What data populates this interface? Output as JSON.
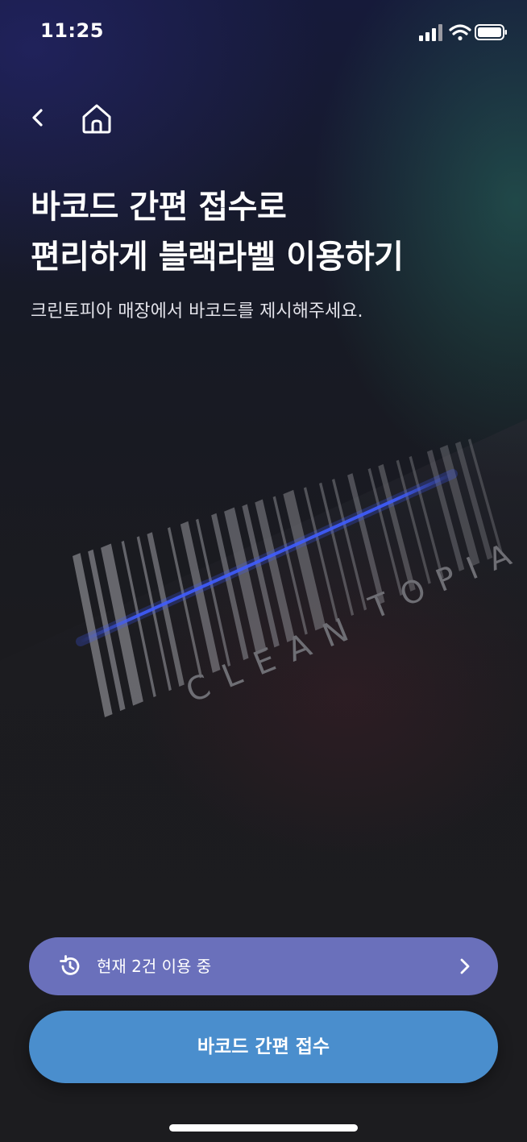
{
  "status_bar": {
    "time": "11:25"
  },
  "nav": {
    "back_icon": "chevron-left-icon",
    "home_icon": "home-icon"
  },
  "heading": {
    "line1": "바코드 간편 접수로",
    "line2": "편리하게 블랙라벨 이용하기"
  },
  "subtitle": "크린토피아 매장에서 바코드를 제시해주세요.",
  "illustration": {
    "brand_text_left": "CLEAN",
    "brand_text_right": "TOPIA"
  },
  "usage_status": {
    "label": "현재 2건 이용 중",
    "icon": "history-icon"
  },
  "primary_action": {
    "label": "바코드 간편 접수"
  },
  "colors": {
    "usage_pill": "#6a70bb",
    "primary_button": "#4a8ecd",
    "scan_line": "#3f5cff"
  }
}
